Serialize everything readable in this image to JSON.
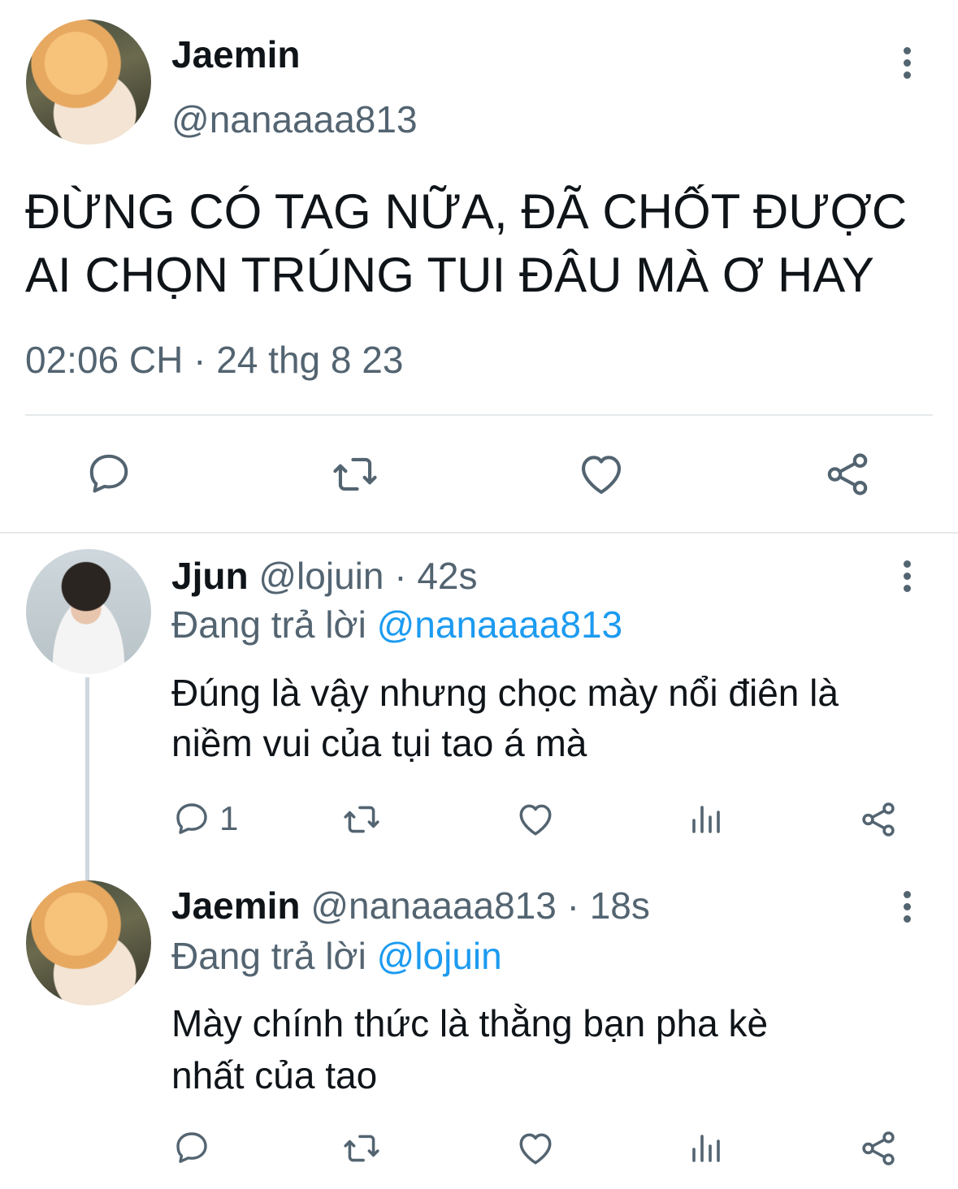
{
  "main_tweet": {
    "author_name": "Jaemin",
    "author_handle": "@nanaaaa813",
    "text_line1": "ĐỪNG CÓ TAG NỮA, ĐÃ CHỐT ĐƯỢC",
    "text_line2": "AI CHỌN TRÚNG TUI ĐÂU MÀ Ơ HAY",
    "timestamp": "02:06 CH · 24 thg 8 23"
  },
  "replies": [
    {
      "author_name": "Jjun",
      "author_handle": "@lojuin",
      "time": "· 42s",
      "replying_label": "Đang trả lời",
      "replying_to": "@nanaaaa813",
      "text_line1": "Đúng là vậy nhưng chọc mày nổi điên là",
      "text_line2": "niềm vui của tụi tao á mà",
      "reply_count": "1"
    },
    {
      "author_name": "Jaemin",
      "author_handle": "@nanaaaa813",
      "time": "· 18s",
      "replying_label": "Đang trả lời",
      "replying_to": "@lojuin",
      "text_line1": "Mày chính thức là thằng bạn pha kè",
      "text_line2": "nhất của tao",
      "reply_count": ""
    }
  ],
  "icons": {
    "reply": "reply-icon",
    "retweet": "retweet-icon",
    "like": "heart-icon",
    "share": "share-icon",
    "views": "views-icon",
    "more": "more-vertical-icon"
  },
  "colors": {
    "text": "#0f1419",
    "secondary": "#536471",
    "link": "#1d9bf0",
    "divider": "#e6e9eb"
  }
}
